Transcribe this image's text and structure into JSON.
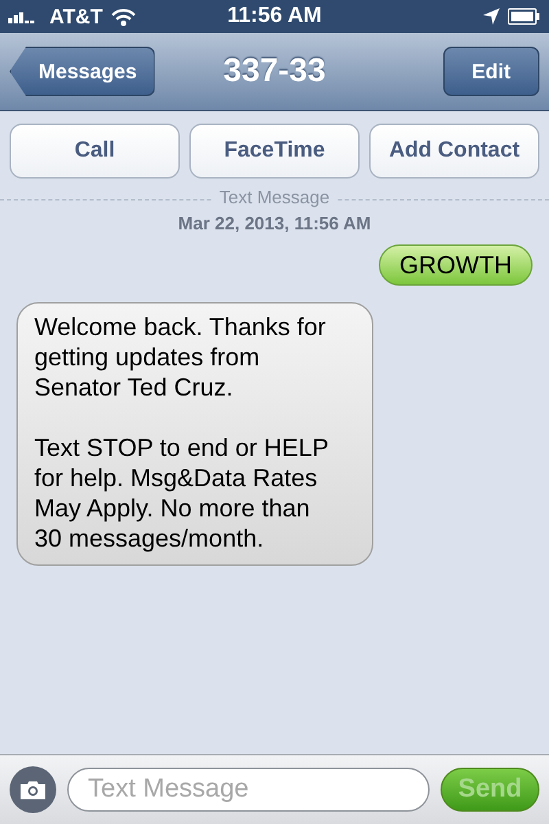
{
  "status_bar": {
    "carrier": "AT&T",
    "time": "11:56 AM"
  },
  "nav": {
    "back": "Messages",
    "title": "337-33",
    "edit": "Edit"
  },
  "actions": [
    "Call",
    "FaceTime",
    "Add Contact"
  ],
  "thread": {
    "service": "Text Message",
    "date": "Mar 22, 2013, 11:56 AM"
  },
  "messages": [
    {
      "kind": "sent",
      "text": "GROWTH"
    },
    {
      "kind": "received",
      "text": "Welcome back. Thanks for getting updates from Senator Ted Cruz.\n\nText STOP to end or HELP for help. Msg&Data Rates May Apply. No more than 30 messages/month."
    }
  ],
  "composer": {
    "placeholder": "Text Message",
    "send": "Send",
    "send_disabled": true
  }
}
